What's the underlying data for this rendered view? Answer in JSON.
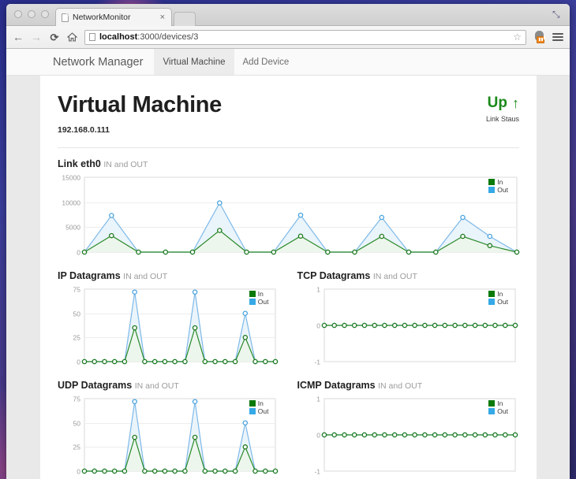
{
  "browser": {
    "tab_title": "NetworkMonitor",
    "tab_close": "×",
    "back_icon": "←",
    "forward_icon": "→",
    "reload_icon": "⟳",
    "url_host": "localhost",
    "url_rest": ":3000/devices/3",
    "star_icon": "☆",
    "maximize_icon": "⤡"
  },
  "navbar": {
    "brand": "Network Manager",
    "items": [
      {
        "label": "Virtual Machine",
        "active": true
      },
      {
        "label": "Add Device",
        "active": false
      }
    ]
  },
  "page": {
    "title": "Virtual Machine",
    "ip": "192.168.0.111",
    "status_value": "Up",
    "status_arrow": "↑",
    "status_label": "Link Staus",
    "status_color": "#1a8a1a"
  },
  "legend": {
    "in": "In",
    "out": "Out",
    "in_color": "#0b7a0b",
    "out_color": "#36a9e6"
  },
  "colors": {
    "in_line": "#2a8a2a",
    "in_fill": "#edf6ec",
    "out_line": "#7eb9e8",
    "out_fill": "#eaf4fb",
    "axis": "#d8d8d8",
    "tick_text": "#9a9a9a"
  },
  "sections": [
    {
      "key": "link",
      "name": "Link eth0",
      "sub": "IN and OUT"
    },
    {
      "key": "ip",
      "name": "IP Datagrams",
      "sub": "IN and OUT"
    },
    {
      "key": "tcp",
      "name": "TCP Datagrams",
      "sub": "IN and OUT"
    },
    {
      "key": "udp",
      "name": "UDP Datagrams",
      "sub": "IN and OUT"
    },
    {
      "key": "icmp",
      "name": "ICMP Datagrams",
      "sub": "IN and OUT"
    }
  ],
  "chart_data": [
    {
      "id": "link",
      "type": "line",
      "title": "Link eth0",
      "subtitle": "IN and OUT",
      "xlabel": "",
      "ylabel": "",
      "ylim": [
        0,
        15000
      ],
      "yticks": [
        0,
        5000,
        10000,
        15000
      ],
      "ytick_labels": [
        "0",
        "5000",
        "10000",
        "15000"
      ],
      "grid": true,
      "legend_position": "top-right",
      "x": [
        0,
        1,
        2,
        3,
        4,
        5,
        6,
        7,
        8,
        9,
        10,
        11,
        12,
        13,
        14,
        15,
        16
      ],
      "series": [
        {
          "name": "In",
          "values": [
            0,
            3300,
            0,
            0,
            0,
            4350,
            0,
            0,
            3200,
            0,
            0,
            3150,
            0,
            0,
            3150,
            1300,
            0
          ]
        },
        {
          "name": "Out",
          "values": [
            0,
            7350,
            0,
            0,
            0,
            9850,
            0,
            0,
            7400,
            0,
            0,
            6950,
            0,
            0,
            6950,
            3150,
            0
          ]
        }
      ]
    },
    {
      "id": "ip",
      "type": "line",
      "title": "IP Datagrams",
      "subtitle": "IN and OUT",
      "xlabel": "",
      "ylabel": "",
      "ylim": [
        0,
        75
      ],
      "yticks": [
        0,
        25,
        50,
        75
      ],
      "ytick_labels": [
        "0",
        "25",
        "50",
        "75"
      ],
      "grid": true,
      "legend_position": "top-right",
      "x": [
        0,
        1,
        2,
        3,
        4,
        5,
        6,
        7,
        8,
        9,
        10,
        11,
        12,
        13,
        14,
        15,
        16,
        17,
        18,
        19
      ],
      "series": [
        {
          "name": "In",
          "values": [
            0,
            0,
            0,
            0,
            0,
            35,
            0,
            0,
            0,
            0,
            0,
            35,
            0,
            0,
            0,
            0,
            25,
            0,
            0,
            0
          ]
        },
        {
          "name": "Out",
          "values": [
            0,
            0,
            0,
            0,
            0,
            72,
            0,
            0,
            0,
            0,
            0,
            72,
            0,
            0,
            0,
            0,
            50,
            0,
            0,
            0
          ]
        }
      ]
    },
    {
      "id": "tcp",
      "type": "line",
      "title": "TCP Datagrams",
      "subtitle": "IN and OUT",
      "xlabel": "",
      "ylabel": "",
      "ylim": [
        -1,
        1
      ],
      "yticks": [
        -1,
        0,
        1
      ],
      "ytick_labels": [
        "-1",
        "0",
        "1"
      ],
      "grid": false,
      "legend_position": "top-right",
      "x": [
        0,
        1,
        2,
        3,
        4,
        5,
        6,
        7,
        8,
        9,
        10,
        11,
        12,
        13,
        14,
        15,
        16,
        17,
        18,
        19
      ],
      "series": [
        {
          "name": "In",
          "values": [
            0,
            0,
            0,
            0,
            0,
            0,
            0,
            0,
            0,
            0,
            0,
            0,
            0,
            0,
            0,
            0,
            0,
            0,
            0,
            0
          ]
        },
        {
          "name": "Out",
          "values": [
            0,
            0,
            0,
            0,
            0,
            0,
            0,
            0,
            0,
            0,
            0,
            0,
            0,
            0,
            0,
            0,
            0,
            0,
            0,
            0
          ]
        }
      ]
    },
    {
      "id": "udp",
      "type": "line",
      "title": "UDP Datagrams",
      "subtitle": "IN and OUT",
      "xlabel": "",
      "ylabel": "",
      "ylim": [
        0,
        75
      ],
      "yticks": [
        0,
        25,
        50,
        75
      ],
      "ytick_labels": [
        "0",
        "25",
        "50",
        "75"
      ],
      "grid": true,
      "legend_position": "top-right",
      "x": [
        0,
        1,
        2,
        3,
        4,
        5,
        6,
        7,
        8,
        9,
        10,
        11,
        12,
        13,
        14,
        15,
        16,
        17,
        18,
        19
      ],
      "series": [
        {
          "name": "In",
          "values": [
            0,
            0,
            0,
            0,
            0,
            35,
            0,
            0,
            0,
            0,
            0,
            35,
            0,
            0,
            0,
            0,
            25,
            0,
            0,
            0
          ]
        },
        {
          "name": "Out",
          "values": [
            0,
            0,
            0,
            0,
            0,
            72,
            0,
            0,
            0,
            0,
            0,
            72,
            0,
            0,
            0,
            0,
            50,
            0,
            0,
            0
          ]
        }
      ]
    },
    {
      "id": "icmp",
      "type": "line",
      "title": "ICMP Datagrams",
      "subtitle": "IN and OUT",
      "xlabel": "",
      "ylabel": "",
      "ylim": [
        -1,
        1
      ],
      "yticks": [
        -1,
        0,
        1
      ],
      "ytick_labels": [
        "-1",
        "0",
        "1"
      ],
      "grid": false,
      "legend_position": "top-right",
      "x": [
        0,
        1,
        2,
        3,
        4,
        5,
        6,
        7,
        8,
        9,
        10,
        11,
        12,
        13,
        14,
        15,
        16,
        17,
        18,
        19
      ],
      "series": [
        {
          "name": "In",
          "values": [
            0,
            0,
            0,
            0,
            0,
            0,
            0,
            0,
            0,
            0,
            0,
            0,
            0,
            0,
            0,
            0,
            0,
            0,
            0,
            0
          ]
        },
        {
          "name": "Out",
          "values": [
            0,
            0,
            0,
            0,
            0,
            0,
            0,
            0,
            0,
            0,
            0,
            0,
            0,
            0,
            0,
            0,
            0,
            0,
            0,
            0
          ]
        }
      ]
    }
  ]
}
